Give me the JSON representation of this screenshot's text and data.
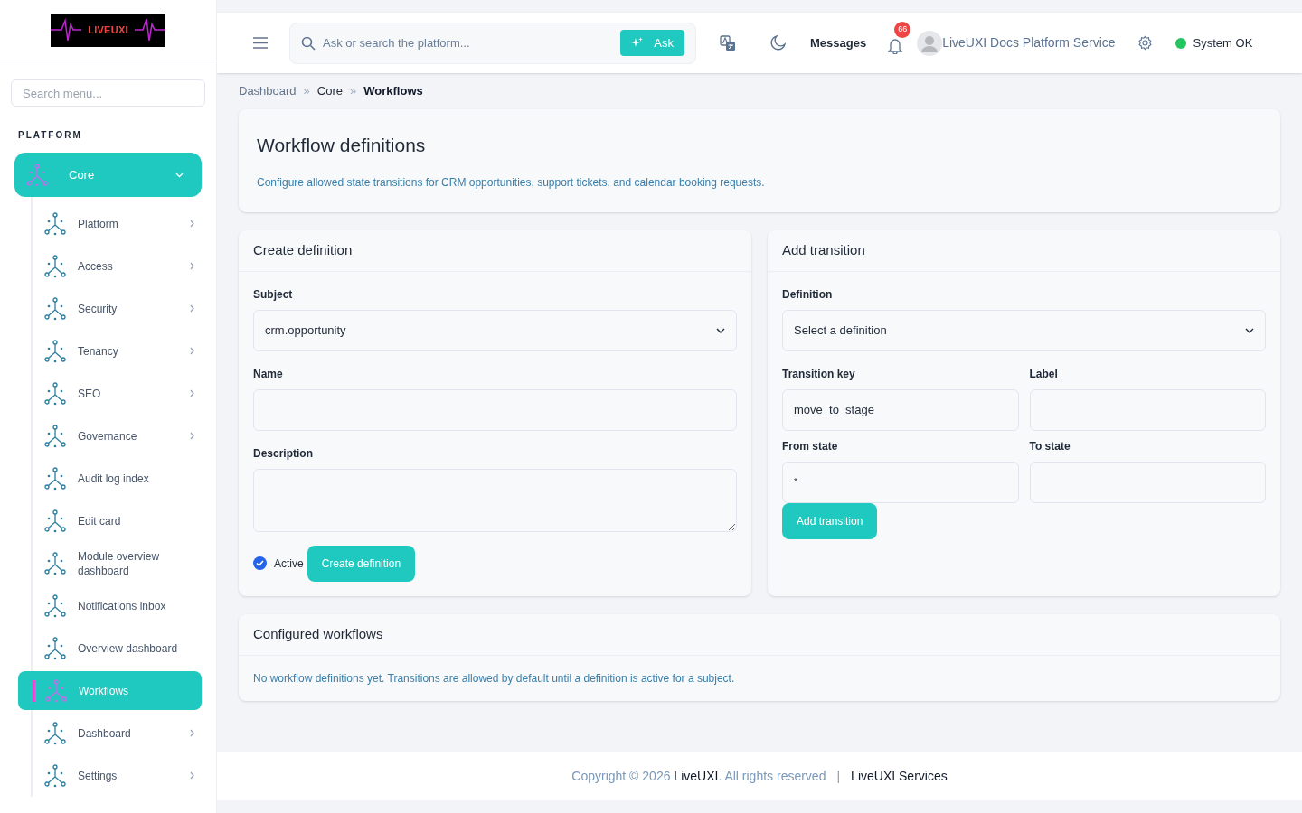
{
  "logo": {
    "text": "LIVEUXI"
  },
  "sidebar": {
    "search": {
      "placeholder": "Search menu..."
    },
    "section": "PLATFORM",
    "items": [
      {
        "label": "Core",
        "expandable": true,
        "expanded": true,
        "selected": true,
        "children": [
          {
            "label": "Platform",
            "expandable": true,
            "selected": false
          },
          {
            "label": "Access",
            "expandable": true,
            "selected": false
          },
          {
            "label": "Security",
            "expandable": true,
            "selected": false
          },
          {
            "label": "Tenancy",
            "expandable": true,
            "selected": false
          },
          {
            "label": "SEO",
            "expandable": true,
            "selected": false
          },
          {
            "label": "Governance",
            "expandable": true,
            "selected": false
          },
          {
            "label": "Audit log index",
            "expandable": false,
            "selected": false
          },
          {
            "label": "Edit card",
            "expandable": false,
            "selected": false
          },
          {
            "label": "Module overview dashboard",
            "expandable": false,
            "selected": false
          },
          {
            "label": "Notifications inbox",
            "expandable": false,
            "selected": false
          },
          {
            "label": "Overview dashboard",
            "expandable": false,
            "selected": false
          },
          {
            "label": "Workflows",
            "expandable": false,
            "selected": true
          },
          {
            "label": "Dashboard",
            "expandable": true,
            "selected": false
          },
          {
            "label": "Settings",
            "expandable": true,
            "selected": false
          }
        ]
      }
    ]
  },
  "header": {
    "search": {
      "placeholder": "Ask or search the platform..."
    },
    "ask_button": "Ask",
    "messages": "Messages",
    "notification_count": "66",
    "user": "LiveUXI Docs Platform Service",
    "status": {
      "label": "System OK",
      "color": "#22c55e"
    }
  },
  "breadcrumb": {
    "separator": "»",
    "items": [
      "Dashboard",
      "Core",
      "Workflows"
    ]
  },
  "page": {
    "title": "Workflow definitions",
    "description": "Configure allowed state transitions for CRM opportunities, support tickets, and calendar booking requests."
  },
  "create_definition": {
    "title": "Create definition",
    "subject": {
      "label": "Subject",
      "value": "crm.opportunity"
    },
    "name": {
      "label": "Name"
    },
    "description": {
      "label": "Description"
    },
    "active": {
      "label": "Active",
      "checked": true
    },
    "button": "Create definition"
  },
  "add_transition": {
    "title": "Add transition",
    "definition": {
      "label": "Definition",
      "value": "Select a definition"
    },
    "transition_key": {
      "label": "Transition key",
      "value": "move_to_stage"
    },
    "label": {
      "label": "Label"
    },
    "from_state": {
      "label": "From state",
      "value": "*"
    },
    "to_state": {
      "label": "To state"
    },
    "button": "Add transition"
  },
  "configured": {
    "title": "Configured workflows",
    "empty": "No workflow definitions yet. Transitions are allowed by default until a definition is active for a subject."
  },
  "footer": {
    "prefix": "Copyright © 2026 ",
    "brand": "LiveUXI",
    "suffix": ". All rights reserved",
    "separator": "|",
    "link": "LiveUXI Services"
  }
}
